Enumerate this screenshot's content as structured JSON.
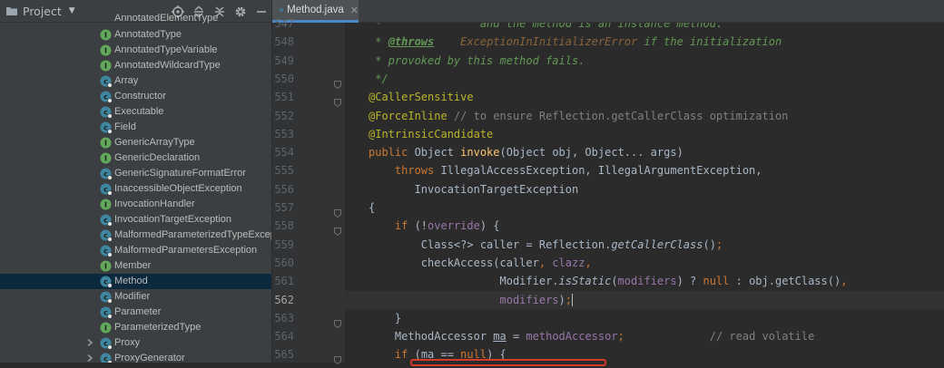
{
  "project_panel": {
    "title": "Project",
    "partial_top_item": "AnnotatedElementType",
    "items": [
      {
        "label": "AnnotatedType",
        "kind": "interface",
        "expandable": false
      },
      {
        "label": "AnnotatedTypeVariable",
        "kind": "interface",
        "expandable": false
      },
      {
        "label": "AnnotatedWildcardType",
        "kind": "interface",
        "expandable": false
      },
      {
        "label": "Array",
        "kind": "class",
        "expandable": false
      },
      {
        "label": "Constructor",
        "kind": "class",
        "expandable": false
      },
      {
        "label": "Executable",
        "kind": "class",
        "expandable": false
      },
      {
        "label": "Field",
        "kind": "class",
        "expandable": false
      },
      {
        "label": "GenericArrayType",
        "kind": "interface",
        "expandable": false
      },
      {
        "label": "GenericDeclaration",
        "kind": "interface",
        "expandable": false
      },
      {
        "label": "GenericSignatureFormatError",
        "kind": "class",
        "expandable": false
      },
      {
        "label": "InaccessibleObjectException",
        "kind": "class",
        "expandable": false
      },
      {
        "label": "InvocationHandler",
        "kind": "interface",
        "expandable": false
      },
      {
        "label": "InvocationTargetException",
        "kind": "class",
        "expandable": false
      },
      {
        "label": "MalformedParameterizedTypeException",
        "kind": "class",
        "expandable": false
      },
      {
        "label": "MalformedParametersException",
        "kind": "class",
        "expandable": false
      },
      {
        "label": "Member",
        "kind": "interface",
        "expandable": false
      },
      {
        "label": "Method",
        "kind": "class",
        "expandable": false,
        "selected": true
      },
      {
        "label": "Modifier",
        "kind": "class",
        "expandable": false
      },
      {
        "label": "Parameter",
        "kind": "class",
        "expandable": false
      },
      {
        "label": "ParameterizedType",
        "kind": "interface",
        "expandable": false
      },
      {
        "label": "Proxy",
        "kind": "class",
        "expandable": true
      },
      {
        "label": "ProxyGenerator",
        "kind": "class",
        "expandable": true
      }
    ]
  },
  "editor": {
    "tab": {
      "label": "Method.java"
    },
    "current_line": "562",
    "lines": [
      {
        "num": "547",
        "html": "<span class=\"cm\"> *               and the method is an instance method.</span>"
      },
      {
        "num": "548",
        "html": "<span class=\"cm\"> * </span><span class=\"jt\">@throws</span><span class=\"cm\">    </span><span class=\"jr\">ExceptionInInitializerError</span><span class=\"cm\"> if the initialization</span>"
      },
      {
        "num": "549",
        "html": "<span class=\"cm\"> * provoked by this method fails.</span>"
      },
      {
        "num": "550",
        "html": "<span class=\"cm\"> */</span>"
      },
      {
        "num": "551",
        "html": "<span class=\"an\">@CallerSensitive</span>"
      },
      {
        "num": "552",
        "html": "<span class=\"an\">@ForceInline</span> <span class=\"lc\">// to ensure Reflection.getCallerClass optimization</span>"
      },
      {
        "num": "553",
        "html": "<span class=\"an\">@IntrinsicCandidate</span>"
      },
      {
        "num": "554",
        "html": "<span class=\"kw\">public</span> Object <span class=\"fn\">invoke</span>(Object obj, Object... args)"
      },
      {
        "num": "555",
        "html": "    <span class=\"kw\">throws</span> IllegalAccessException, IllegalArgumentException,"
      },
      {
        "num": "556",
        "html": "       InvocationTargetException"
      },
      {
        "num": "557",
        "html": "{"
      },
      {
        "num": "558",
        "html": "    <span class=\"kw\">if</span> (!<span class=\"fi\">override</span>) {"
      },
      {
        "num": "559",
        "html": "        Class&lt;?&gt; caller = Reflection.<span class=\"st\">getCallerClass</span>()<span class=\"kw\">;</span>"
      },
      {
        "num": "560",
        "html": "        checkAccess(caller<span class=\"kw\">,</span> <span class=\"fi\">clazz</span><span class=\"kw\">,</span>"
      },
      {
        "num": "561",
        "html": "                    Modifier.<span class=\"st\">isStatic</span>(<span class=\"fi\">modifiers</span>) ? <span class=\"kw\">null</span> : obj.getClass()<span class=\"kw\">,</span>"
      },
      {
        "num": "562",
        "html": "                    <span class=\"fi\">modifiers</span>)<span class=\"kw\">;</span><span class=\"caret\"></span>"
      },
      {
        "num": "563",
        "html": "    }"
      },
      {
        "num": "564",
        "html": "    MethodAccessor <span class=\"ul\">ma</span> = <span class=\"fi\">methodAccessor</span><span class=\"kw\">;</span>             <span class=\"lc\">// read volatile</span>"
      },
      {
        "num": "565",
        "html": "    <span class=\"kw\">if</span> (<span class=\"ul\">ma</span> == <span class=\"kw\">null</span>) {"
      }
    ],
    "fold_markers": [
      "550",
      "551",
      "557",
      "558",
      "563",
      "565"
    ]
  },
  "colors": {
    "accent": "#4a88c7",
    "selection": "#0d293e",
    "highlight_box": "#d23b2a"
  }
}
